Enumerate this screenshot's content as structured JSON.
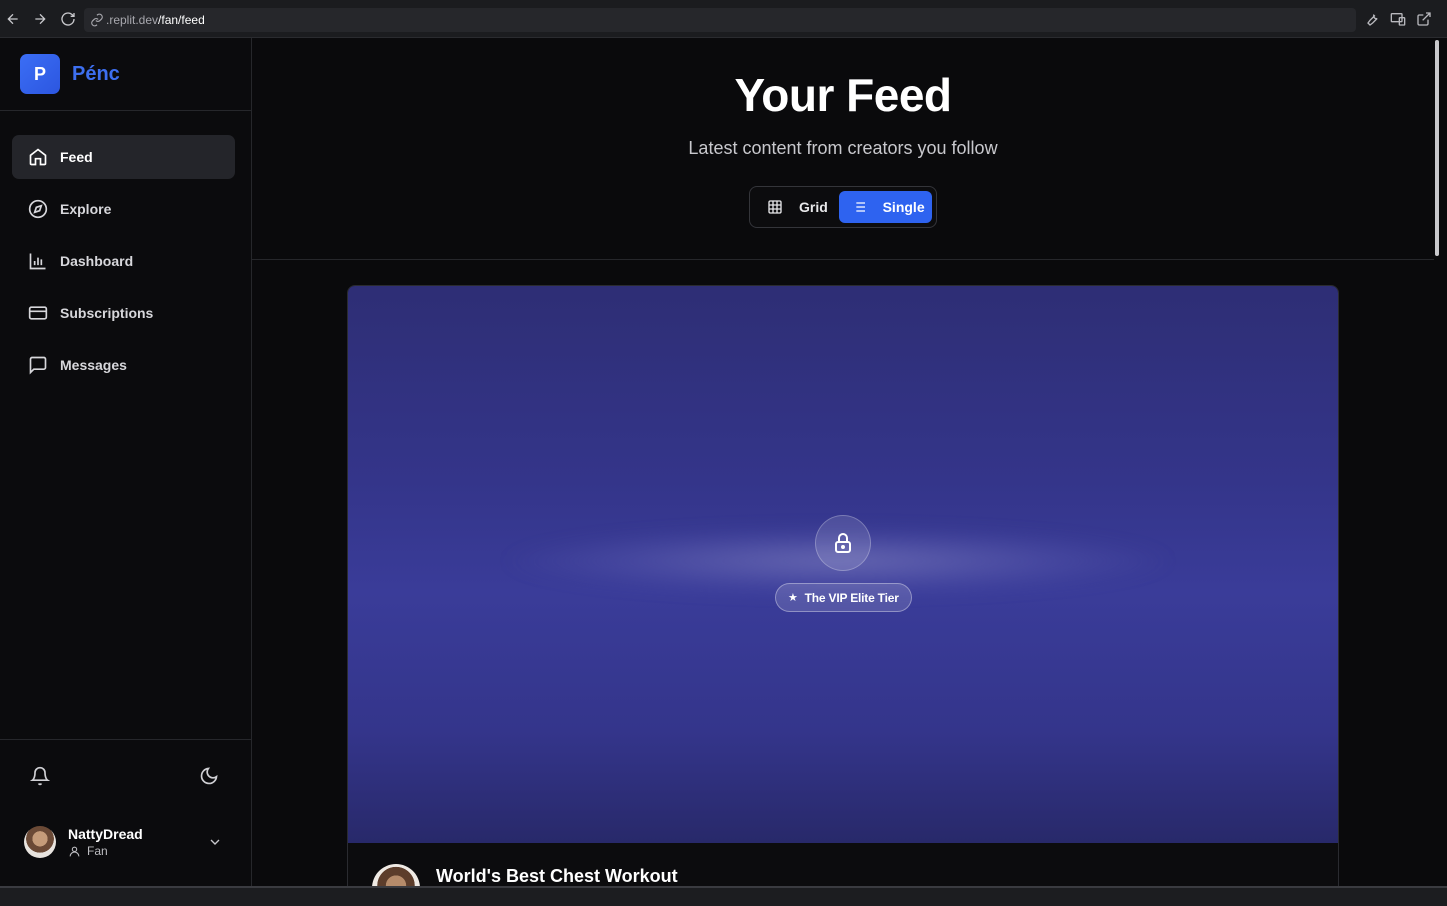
{
  "browser": {
    "url_domain": ".replit.dev",
    "url_path": "/fan/feed"
  },
  "sidebar": {
    "brand_initial": "P",
    "brand_name": "Pénc",
    "items": [
      {
        "label": "Feed",
        "icon": "home-icon",
        "active": true
      },
      {
        "label": "Explore",
        "icon": "compass-icon",
        "active": false
      },
      {
        "label": "Dashboard",
        "icon": "bar-chart-icon",
        "active": false
      },
      {
        "label": "Subscriptions",
        "icon": "credit-card-icon",
        "active": false
      },
      {
        "label": "Messages",
        "icon": "message-square-icon",
        "active": false
      }
    ],
    "user": {
      "name": "NattyDread",
      "role": "Fan"
    }
  },
  "main": {
    "title": "Your Feed",
    "subtitle": "Latest content from creators you follow",
    "view_toggle": {
      "grid_label": "Grid",
      "single_label": "Single",
      "selected": "Single"
    },
    "post": {
      "tier_label": "The VIP Elite Tier",
      "title": "World's Best Chest Workout",
      "locked": true
    }
  },
  "colors": {
    "accent": "#2e63f0",
    "brand": "#3d6ff0",
    "background": "#0a0a0c",
    "media_gradient": "#34358a"
  }
}
